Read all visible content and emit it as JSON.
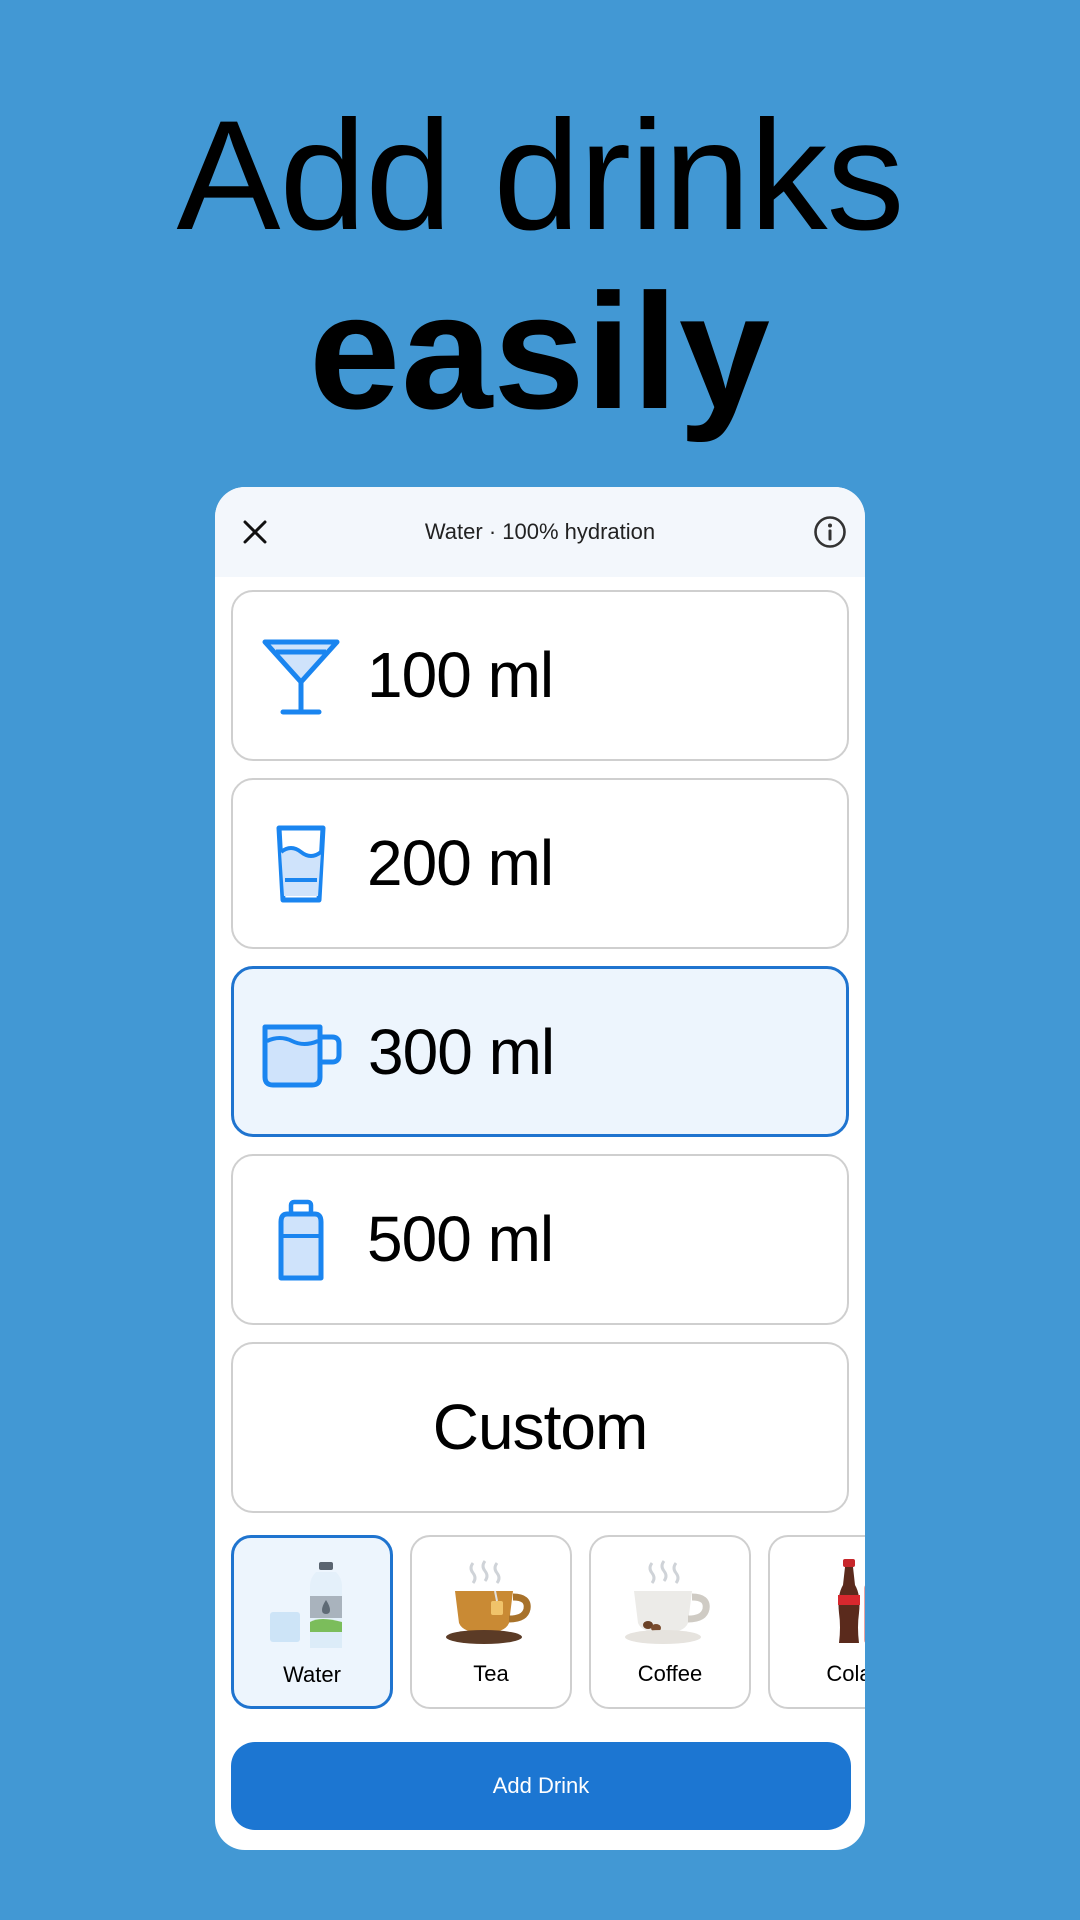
{
  "headline": {
    "line1": "Add drinks",
    "line2": "easily"
  },
  "topbar": {
    "title": "Water · 100% hydration",
    "close_icon": "close-icon",
    "info_icon": "info-icon"
  },
  "options": [
    {
      "label": "100 ml",
      "icon": "cocktail-glass-icon",
      "selected": false
    },
    {
      "label": "200 ml",
      "icon": "water-glass-icon",
      "selected": false
    },
    {
      "label": "300 ml",
      "icon": "mug-icon",
      "selected": true
    },
    {
      "label": "500 ml",
      "icon": "bottle-icon",
      "selected": false
    },
    {
      "label": "Custom",
      "icon": "",
      "selected": false
    }
  ],
  "drinks": [
    {
      "label": "Water",
      "icon": "water-bottle-icon",
      "selected": true
    },
    {
      "label": "Tea",
      "icon": "tea-cup-icon",
      "selected": false
    },
    {
      "label": "Coffee",
      "icon": "coffee-cup-icon",
      "selected": false
    },
    {
      "label": "Cola",
      "icon": "cola-bottle-icon",
      "selected": false
    }
  ],
  "add_button": {
    "label": "Add Drink"
  },
  "colors": {
    "background": "#4298d4",
    "accent": "#1c76d2",
    "selected_fill": "#edf5fd",
    "icon_blue": "#1a85f0"
  }
}
